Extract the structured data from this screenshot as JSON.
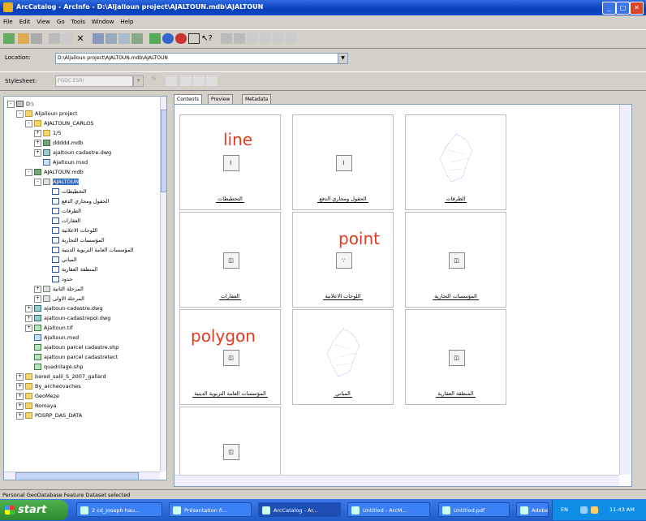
{
  "window": {
    "title": "ArcCatalog - ArcInfo - D:\\Aljalloun project\\AJALTOUN.mdb\\AJALTOUN"
  },
  "menu": [
    "File",
    "Edit",
    "View",
    "Go",
    "Tools",
    "Window",
    "Help"
  ],
  "location": {
    "label": "Location:",
    "value": "D:\\Aljalloun project\\AJALTOUN.mdb\\AJALTOUN"
  },
  "stylesheet": {
    "label": "Stylesheet:",
    "value": "FGDC ESRI"
  },
  "tree": [
    {
      "label": "D:\\",
      "icon": "drive",
      "level": 0,
      "expander": "-"
    },
    {
      "label": "Aljalloun project",
      "icon": "folder",
      "level": 1,
      "expander": "-"
    },
    {
      "label": "AJALTOUN_CARLOS",
      "icon": "folder",
      "level": 2,
      "expander": "-"
    },
    {
      "label": "1/5",
      "icon": "folder",
      "level": 3,
      "expander": "+"
    },
    {
      "label": "ddddd.mdb",
      "icon": "gdb",
      "level": 3,
      "expander": "+"
    },
    {
      "label": "ajaltoun cadastre.dwg",
      "icon": "cad",
      "level": 3,
      "expander": "+"
    },
    {
      "label": "Ajaltoun.mxd",
      "icon": "mxd",
      "level": 3,
      "expander": ""
    },
    {
      "label": "AJALTOUN.mdb",
      "icon": "gdb",
      "level": 2,
      "expander": "-"
    },
    {
      "label": "AJALTOUN",
      "icon": "fd",
      "level": 3,
      "expander": "-",
      "selected": true
    },
    {
      "label": "التخطيطات",
      "icon": "fc",
      "level": 4,
      "expander": ""
    },
    {
      "label": "الحقول ومجاري الدفع",
      "icon": "fc",
      "level": 4,
      "expander": ""
    },
    {
      "label": "الطرقات",
      "icon": "fc",
      "level": 4,
      "expander": ""
    },
    {
      "label": "العقارات",
      "icon": "fc",
      "level": 4,
      "expander": ""
    },
    {
      "label": "اللوحات الاعلانية",
      "icon": "fc",
      "level": 4,
      "expander": ""
    },
    {
      "label": "المؤسسات التجارية",
      "icon": "fc",
      "level": 4,
      "expander": ""
    },
    {
      "label": "المؤسسات العامة التربوية الدينية",
      "icon": "fc",
      "level": 4,
      "expander": ""
    },
    {
      "label": "المباني",
      "icon": "fc",
      "level": 4,
      "expander": ""
    },
    {
      "label": "المنطقة العقارية",
      "icon": "fc",
      "level": 4,
      "expander": ""
    },
    {
      "label": "حدود",
      "icon": "fc",
      "level": 4,
      "expander": ""
    },
    {
      "label": "المرحلة الثانية",
      "icon": "fd",
      "level": 3,
      "expander": "+"
    },
    {
      "label": "المرحلة الاولى",
      "icon": "fd",
      "level": 3,
      "expander": "+"
    },
    {
      "label": "ajaltoun-cadastre.dwg",
      "icon": "cad",
      "level": 2,
      "expander": "+"
    },
    {
      "label": "ajaltoun-cadastrepol.dwg",
      "icon": "cad",
      "level": 2,
      "expander": "+"
    },
    {
      "label": "Ajaltoun.tif",
      "icon": "shp",
      "level": 2,
      "expander": "+"
    },
    {
      "label": "Ajaltoun.mxd",
      "icon": "mxd",
      "level": 2,
      "expander": ""
    },
    {
      "label": "ajaltoun parcel cadastre.shp",
      "icon": "shp",
      "level": 2,
      "expander": ""
    },
    {
      "label": "ajaltoun parcel cadastretect",
      "icon": "shp",
      "level": 2,
      "expander": ""
    },
    {
      "label": "quadrilage.shp",
      "icon": "shp",
      "level": 2,
      "expander": ""
    },
    {
      "label": "bared_salil_S_2007_gallard",
      "icon": "folder",
      "level": 1,
      "expander": "+"
    },
    {
      "label": "By_archeovaches",
      "icon": "folder",
      "level": 1,
      "expander": "+"
    },
    {
      "label": "GeoMeze",
      "icon": "folder",
      "level": 1,
      "expander": "+"
    },
    {
      "label": "Roroaya",
      "icon": "folder",
      "level": 1,
      "expander": "+"
    },
    {
      "label": "PDSRP_DAS_DATA",
      "icon": "folder",
      "level": 1,
      "expander": "+"
    }
  ],
  "tabs": [
    "Contents",
    "Preview",
    "Metadata"
  ],
  "contents": [
    {
      "caption": "التخطيطات",
      "thumb": "line"
    },
    {
      "caption": "الحقول ومجاري الدفع",
      "thumb": "line"
    },
    {
      "caption": "الطرقات",
      "thumb": "map"
    },
    {
      "caption": "العقارات",
      "thumb": "polygon"
    },
    {
      "caption": "اللوحات الاعلانية",
      "thumb": "point"
    },
    {
      "caption": "المؤسسات التجارية",
      "thumb": "polygon"
    },
    {
      "caption": "المؤسسات العامة التربوية الدينية",
      "thumb": "polygon"
    },
    {
      "caption": "المباني",
      "thumb": "map"
    },
    {
      "caption": "المنطقة العقارية",
      "thumb": "polygon"
    },
    {
      "caption": "",
      "thumb": "polygon"
    }
  ],
  "overlays": {
    "line": "line",
    "point": "point",
    "polygon": "polygon"
  },
  "status": "Personal GeoDatabase Feature Dataset selected",
  "taskbar": {
    "start": "start",
    "tasks": [
      "2 cd_Joseph hau...",
      "Présentation fi...",
      "ArcCatalog - Ar...",
      "Untitled - ArcM...",
      "Untitled.pdf",
      "Adobe Photoshop"
    ],
    "tray_lang": "EN",
    "clock": "11:43 AM"
  },
  "colors": {
    "overlay": "#e23a1f",
    "titlebar": "#0a3fb8",
    "selection": "#316ac5"
  }
}
